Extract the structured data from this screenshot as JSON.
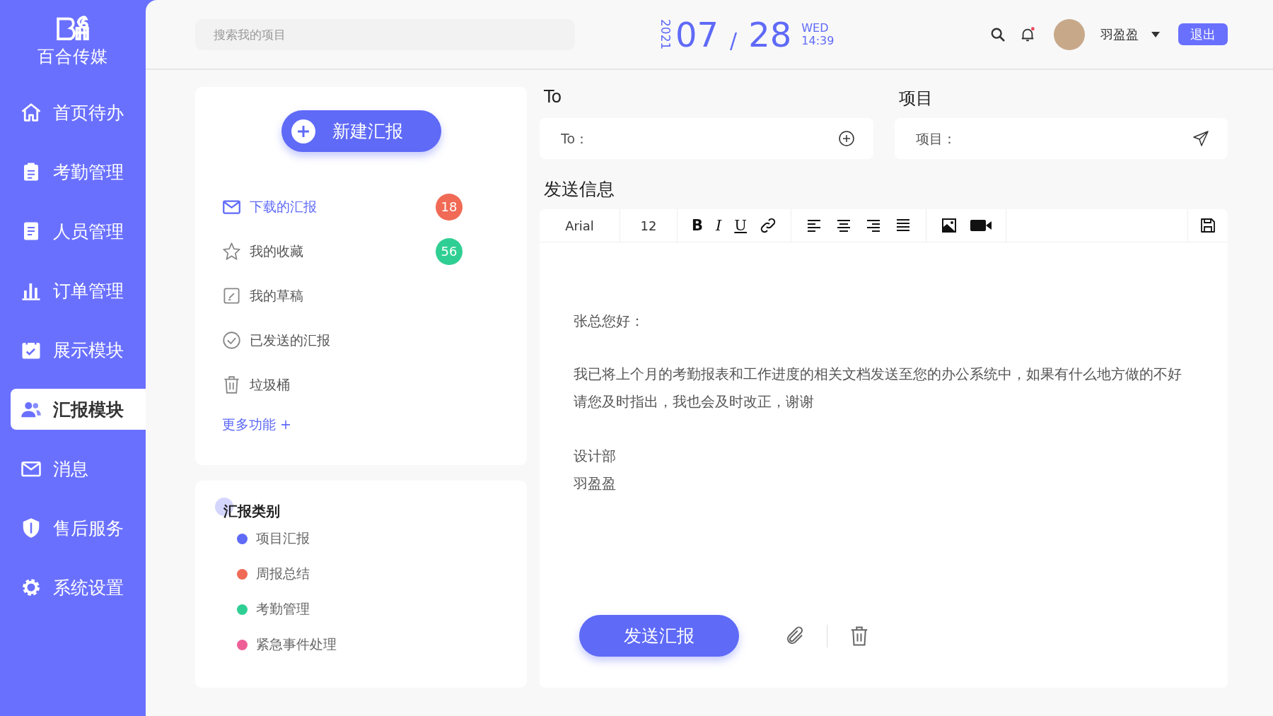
{
  "brand": {
    "name": "百合传媒"
  },
  "sidebar": {
    "items": [
      {
        "label": "首页待办",
        "kind": "home",
        "selected": false
      },
      {
        "label": "考勤管理",
        "kind": "clipboard",
        "selected": false
      },
      {
        "label": "人员管理",
        "kind": "document",
        "selected": false
      },
      {
        "label": "订单管理",
        "kind": "chart",
        "selected": false
      },
      {
        "label": "展示模块",
        "kind": "calendar",
        "selected": false
      },
      {
        "label": "汇报模块",
        "kind": "people",
        "selected": true
      },
      {
        "label": "消息",
        "kind": "mail",
        "selected": false
      },
      {
        "label": "售后服务",
        "kind": "shield",
        "selected": false
      },
      {
        "label": "系统设置",
        "kind": "gear",
        "selected": false
      }
    ]
  },
  "header": {
    "search": {
      "placeholder": "搜索我的项目"
    },
    "date": {
      "year": "2021",
      "month": "07",
      "separator": "/",
      "day": "28",
      "weekday": "WED",
      "time": "14:39"
    },
    "notifications": {
      "unread": true
    },
    "user": {
      "name": "羽盈盈"
    },
    "logout": "退出"
  },
  "reports": {
    "new_button": "新建汇报",
    "items": [
      {
        "label": "下载的汇报",
        "kind": "mail",
        "selected": true,
        "count": "18",
        "color": "#f06a55"
      },
      {
        "label": "我的收藏",
        "kind": "star",
        "selected": false,
        "count": "56",
        "color": "#2fcf93"
      },
      {
        "label": "我的草稿",
        "kind": "draft",
        "selected": false
      },
      {
        "label": "已发送的汇报",
        "kind": "check",
        "selected": false
      },
      {
        "label": "垃圾桶",
        "kind": "trash",
        "selected": false
      }
    ],
    "more": "更多功能 +"
  },
  "categories": {
    "title": "汇报类别",
    "items": [
      {
        "label": "项目汇报",
        "color": "#5f6af7"
      },
      {
        "label": "周报总结",
        "color": "#f06a55"
      },
      {
        "label": "考勤管理",
        "color": "#2fcf93"
      },
      {
        "label": "紧急事件处理",
        "color": "#ee5f97"
      }
    ]
  },
  "compose": {
    "to": {
      "title": "To",
      "placeholder": "To："
    },
    "project": {
      "title": "项目",
      "placeholder": "项目："
    },
    "message_title": "发送信息",
    "toolbar": {
      "font": "Arial",
      "size": "12",
      "format": [
        "B",
        "I",
        "U"
      ]
    },
    "body": {
      "greeting": "张总您好：",
      "paragraph": "我已将上个月的考勤报表和工作进度的相关文档发送至您的办公系统中，如果有什么地方做的不好请您及时指出，我也会及时改正，谢谢",
      "signature": [
        "设计部",
        "羽盈盈"
      ]
    },
    "send_button": "发送汇报"
  }
}
